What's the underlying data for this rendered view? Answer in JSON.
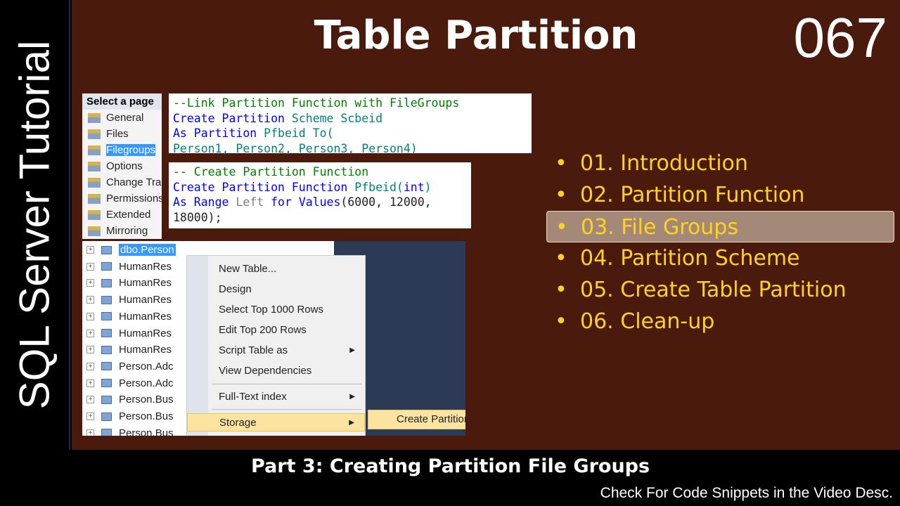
{
  "side_title": "SQL Server Tutorial",
  "title": "Table Partition",
  "episode": "067",
  "pages_panel": {
    "header": "Select a page",
    "items": [
      "General",
      "Files",
      "Filegroups",
      "Options",
      "Change Tracking",
      "Permissions",
      "Extended",
      "Mirroring"
    ],
    "selected": "Filegroups"
  },
  "code1": {
    "comment": "--Link Partition Function with FileGroups",
    "l2a": "Create Partition ",
    "l2b": "Scheme Scbeid",
    "l3a": "As Partition ",
    "l3b": "Pfbeid To(",
    "l4": "Person1, Person2, Person3, Person4)"
  },
  "code2": {
    "comment": "-- Create Partition Function",
    "l2a": "Create Partition Function ",
    "l2b": "Pfbeid(",
    "l2c": "int",
    ")": ")",
    "l3a": "As Range ",
    "l3b": "Left ",
    "l3c": "for Values",
    "l3d": "(6000, 12000,",
    "l4": "18000);"
  },
  "tree": [
    "dbo.Person",
    "HumanRes",
    "HumanRes",
    "HumanRes",
    "HumanRes",
    "HumanRes",
    "HumanRes",
    "Person.Adc",
    "Person.Adc",
    "Person.Bus",
    "Person.Bus",
    "Person.Bus"
  ],
  "menu": {
    "items": [
      "New Table...",
      "Design",
      "Select Top 1000 Rows",
      "Edit Top 200 Rows",
      "Script Table as",
      "View Dependencies",
      "Full-Text index",
      "Storage"
    ],
    "submenu": "Create Partition"
  },
  "bullets": [
    "01. Introduction",
    "02. Partition Function",
    "03. File Groups",
    "04. Partition Scheme",
    "05. Create Table Partition",
    "06. Clean-up"
  ],
  "active_bullet": 2,
  "part": "Part 3: Creating Partition File Groups",
  "desc": "Check For Code Snippets in the Video Desc."
}
